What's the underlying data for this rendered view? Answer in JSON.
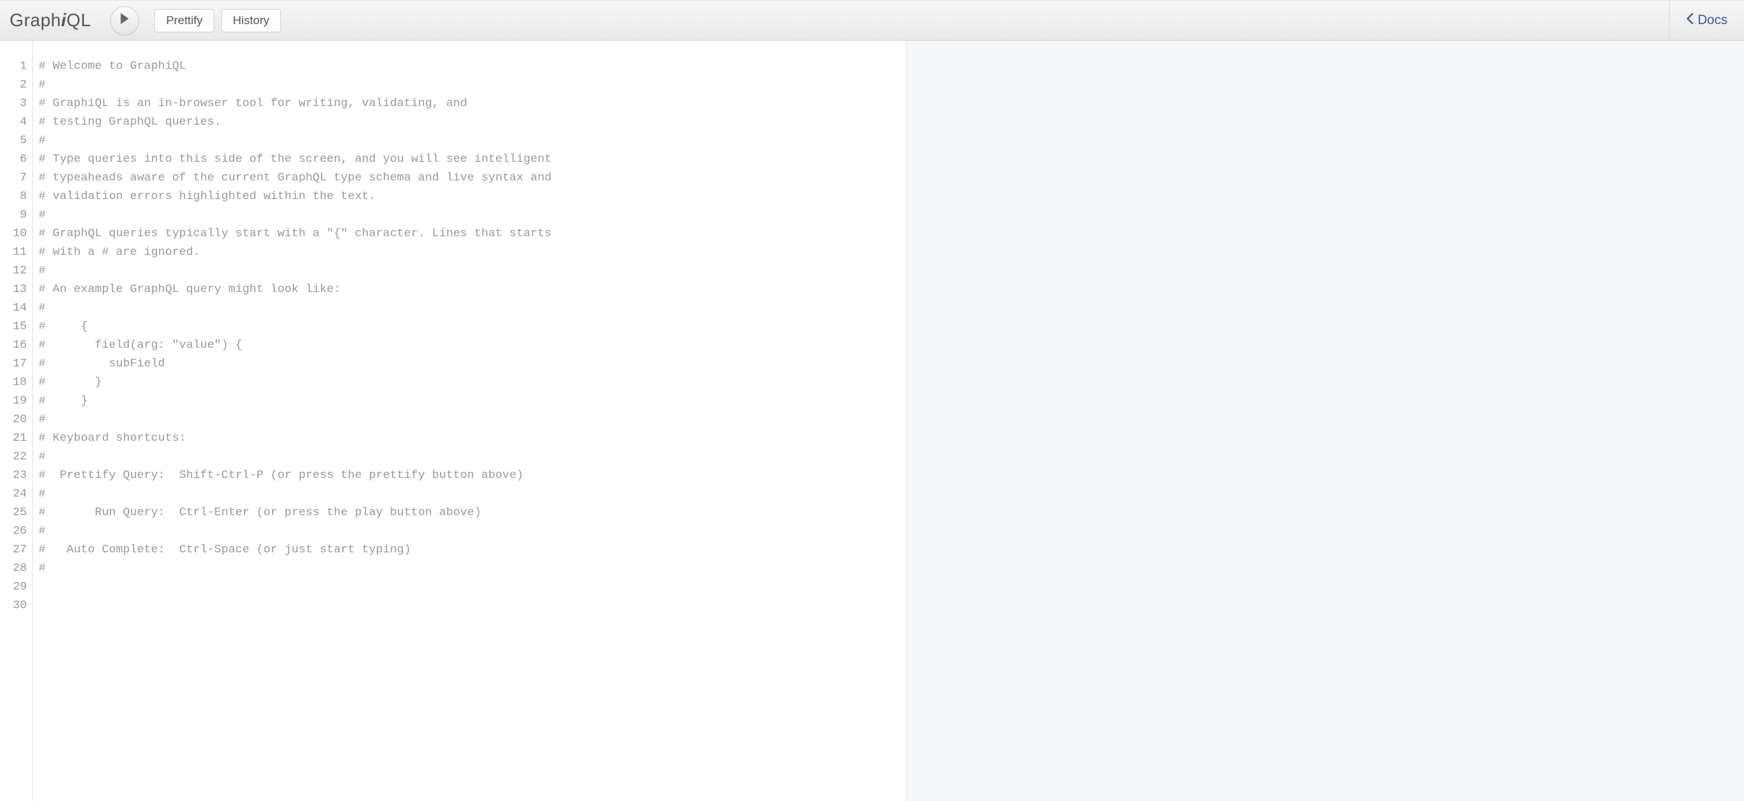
{
  "header": {
    "logo_prefix": "Graph",
    "logo_italic": "i",
    "logo_suffix": "QL",
    "prettify_label": "Prettify",
    "history_label": "History",
    "docs_label": "Docs"
  },
  "editor": {
    "lines": [
      "# Welcome to GraphiQL",
      "#",
      "# GraphiQL is an in-browser tool for writing, validating, and",
      "# testing GraphQL queries.",
      "#",
      "# Type queries into this side of the screen, and you will see intelligent",
      "# typeaheads aware of the current GraphQL type schema and live syntax and",
      "# validation errors highlighted within the text.",
      "#",
      "# GraphQL queries typically start with a \"{\" character. Lines that starts",
      "# with a # are ignored.",
      "#",
      "# An example GraphQL query might look like:",
      "#",
      "#     {",
      "#       field(arg: \"value\") {",
      "#         subField",
      "#       }",
      "#     }",
      "#",
      "# Keyboard shortcuts:",
      "#",
      "#  Prettify Query:  Shift-Ctrl-P (or press the prettify button above)",
      "#",
      "#       Run Query:  Ctrl-Enter (or press the play button above)",
      "#",
      "#   Auto Complete:  Ctrl-Space (or just start typing)",
      "#",
      "",
      ""
    ],
    "visible_line_count": 30
  }
}
